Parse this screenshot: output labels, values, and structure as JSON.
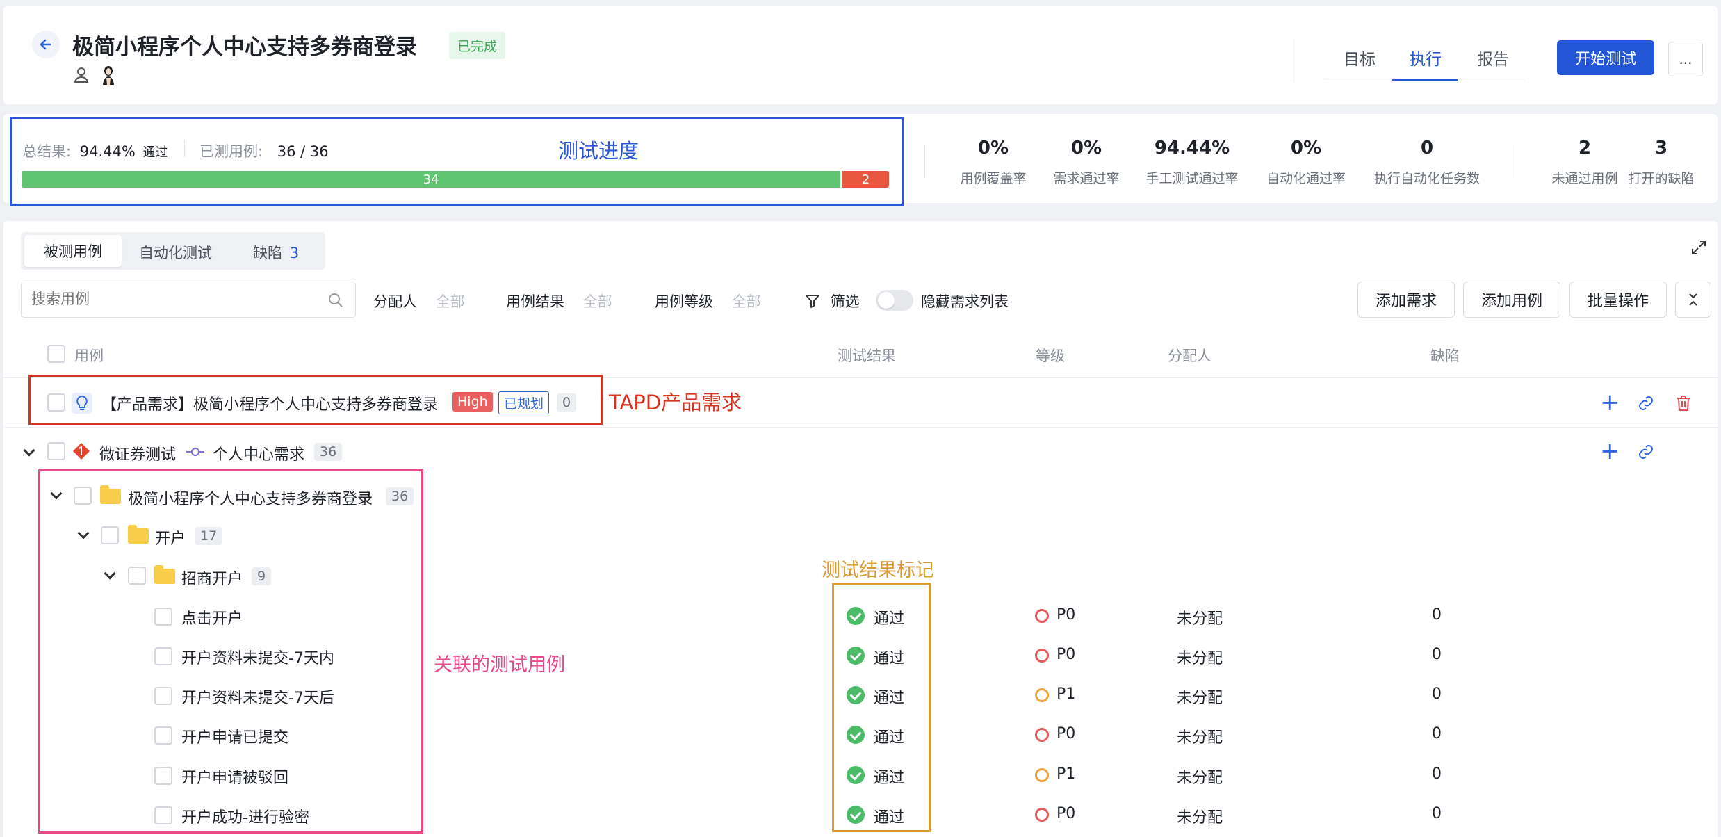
{
  "header": {
    "title": "极简小程序个人中心支持多券商登录",
    "status_badge": "已完成",
    "tabs": [
      {
        "label": "目标",
        "active": false
      },
      {
        "label": "执行",
        "active": true
      },
      {
        "label": "报告",
        "active": false
      }
    ],
    "start_button": "开始测试",
    "more_button": "..."
  },
  "progress": {
    "total_label": "总结果:",
    "total_value": "94.44%",
    "total_suffix": "通过",
    "tested_label": "已测用例:",
    "tested_value": "36 / 36",
    "pass_count": "34",
    "fail_count": "2",
    "pass_fraction": 0.944
  },
  "metrics": [
    {
      "value": "0%",
      "label": "用例覆盖率"
    },
    {
      "value": "0%",
      "label": "需求通过率"
    },
    {
      "value": "94.44%",
      "label": "手工测试通过率"
    },
    {
      "value": "0%",
      "label": "自动化通过率"
    },
    {
      "value": "0",
      "label": "执行自动化任务数"
    },
    {
      "value": "2",
      "label": "未通过用例"
    },
    {
      "value": "3",
      "label": "打开的缺陷"
    }
  ],
  "tabs2": {
    "cases": "被测用例",
    "auto": "自动化测试",
    "defects": "缺陷",
    "defects_count": "3"
  },
  "toolbar": {
    "search_placeholder": "搜索用例",
    "assignee_label": "分配人",
    "assignee_value": "全部",
    "result_label": "用例结果",
    "result_value": "全部",
    "level_label": "用例等级",
    "level_value": "全部",
    "filter_label": "筛选",
    "hide_label": "隐藏需求列表",
    "add_req": "添加需求",
    "add_case": "添加用例",
    "batch": "批量操作"
  },
  "table": {
    "headers": {
      "case": "用例",
      "result": "测试结果",
      "level": "等级",
      "assignee": "分配人",
      "defect": "缺陷"
    },
    "requirement": {
      "title": "【产品需求】极简小程序个人中心支持多券商登录",
      "priority": "High",
      "status": "已规划",
      "count": "0"
    },
    "group": {
      "project": "微证券测试",
      "branch": "个人中心需求",
      "count": "36"
    },
    "folder1": {
      "name": "极简小程序个人中心支持多券商登录",
      "count": "36"
    },
    "folder2": {
      "name": "开户",
      "count": "17"
    },
    "folder3": {
      "name": "招商开户",
      "count": "9"
    },
    "rows": [
      {
        "name": "点击开户",
        "result": "通过",
        "level": "P0",
        "assignee": "未分配",
        "defects": "0"
      },
      {
        "name": "开户资料未提交-7天内",
        "result": "通过",
        "level": "P0",
        "assignee": "未分配",
        "defects": "0"
      },
      {
        "name": "开户资料未提交-7天后",
        "result": "通过",
        "level": "P1",
        "assignee": "未分配",
        "defects": "0"
      },
      {
        "name": "开户申请已提交",
        "result": "通过",
        "level": "P0",
        "assignee": "未分配",
        "defects": "0"
      },
      {
        "name": "开户申请被驳回",
        "result": "通过",
        "level": "P1",
        "assignee": "未分配",
        "defects": "0"
      },
      {
        "name": "开户成功-进行验密",
        "result": "通过",
        "level": "P0",
        "assignee": "未分配",
        "defects": "0"
      }
    ]
  },
  "annotations": {
    "progress": "测试进度",
    "requirement": "TAPD产品需求",
    "cases": "关联的测试用例",
    "result": "测试结果标记"
  },
  "colors": {
    "primary": "#2356d6",
    "pass": "#4cbb67",
    "fail": "#e9573f",
    "anno_blue": "#2a56d8",
    "anno_red": "#d8321f",
    "anno_pink": "#e64888",
    "anno_orange": "#d99a2f"
  }
}
